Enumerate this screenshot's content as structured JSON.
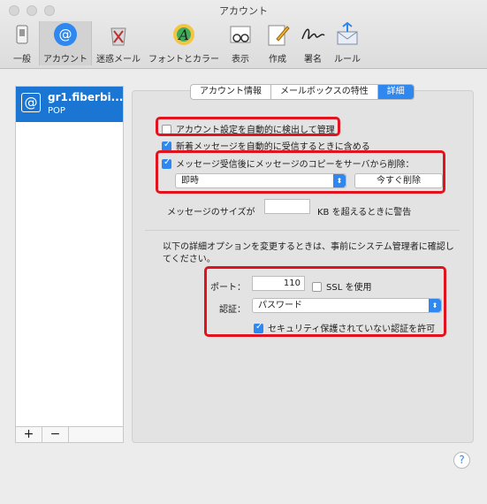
{
  "window": {
    "title": "アカウント"
  },
  "toolbar": {
    "items": [
      {
        "label": "一般"
      },
      {
        "label": "アカウント"
      },
      {
        "label": "迷惑メール"
      },
      {
        "label": "フォントとカラー"
      },
      {
        "label": "表示"
      },
      {
        "label": "作成"
      },
      {
        "label": "署名"
      },
      {
        "label": "ルール"
      }
    ]
  },
  "sidebar": {
    "account": {
      "name": "gr1.fiberbi...",
      "type": "POP"
    },
    "add_label": "+",
    "remove_label": "−"
  },
  "tabs": [
    {
      "label": "アカウント情報"
    },
    {
      "label": "メールボックスの特性"
    },
    {
      "label": "詳細"
    }
  ],
  "advanced": {
    "auto_detect_label": "アカウント設定を自動的に検出して管理",
    "auto_detect_checked": false,
    "include_new_label": "新着メッセージを自動的に受信するときに含める",
    "include_new_checked": true,
    "remove_copy_label": "メッセージ受信後にメッセージのコピーをサーバから削除：",
    "remove_copy_checked": true,
    "remove_when_value": "即時",
    "remove_now_label": "今すぐ削除",
    "size_prefix": "メッセージのサイズが",
    "size_value": "",
    "size_suffix": "KB を超えるときに警告",
    "admin_note": "以下の詳細オプションを変更するときは、事前にシステム管理者に確認してください。",
    "port_label": "ポート：",
    "port_value": "110",
    "ssl_label": "SSL を使用",
    "ssl_checked": false,
    "auth_label": "認証：",
    "auth_value": "パスワード",
    "insecure_auth_label": "セキュリティ保護されていない認証を許可",
    "insecure_auth_checked": true
  },
  "help": {
    "label": "?"
  },
  "colors": {
    "accent": "#2f87f0",
    "selection": "#1b76d3",
    "highlight": "#e0131f"
  }
}
